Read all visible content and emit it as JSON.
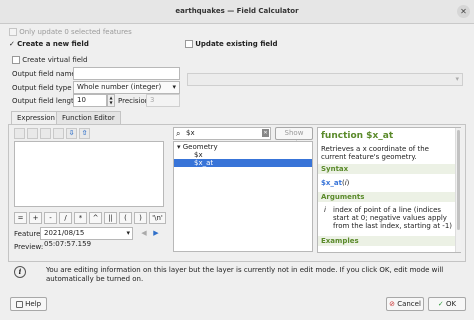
{
  "window": {
    "title": "earthquakes — Field Calculator",
    "close": "✕"
  },
  "only_update": {
    "label": "Only update 0 selected features"
  },
  "create_field": {
    "label": "Create a new field",
    "virtual_label": "Create virtual field",
    "name_label": "Output field name",
    "type_label": "Output field type",
    "type_value": "Whole number (integer)",
    "length_label": "Output field length",
    "length_value": "10",
    "precision_label": "Precision",
    "precision_value": "3"
  },
  "update_existing": {
    "label": "Update existing field"
  },
  "tabs": {
    "expression": "Expression",
    "function_editor": "Function Editor"
  },
  "operators": [
    "=",
    "+",
    "-",
    "/",
    "*",
    "^",
    "||",
    "(",
    ")",
    "'\\n'"
  ],
  "feature": {
    "label": "Feature",
    "value": "2021/08/15 05:07:57.159",
    "preview_label": "Preview:"
  },
  "search": {
    "value": "$x",
    "show_help": "Show Help"
  },
  "tree": {
    "group": "Geometry",
    "items": [
      "$x",
      "$x_at"
    ]
  },
  "help": {
    "title": "function $x_at",
    "description": "Retrieves a x coordinate of the current feature's geometry.",
    "syntax_heading": "Syntax",
    "syntax_fn": "$x_at",
    "syntax_arg": "i",
    "arguments_heading": "Arguments",
    "arg_name": "i",
    "arg_desc": "index of point of a line (indices start at 0; negative values apply from the last index, starting at -1)",
    "examples_heading": "Examples"
  },
  "info": {
    "icon": "i",
    "message": "You are editing information on this layer but the layer is currently not in edit mode. If you click OK, edit mode will automatically be turned on."
  },
  "buttons": {
    "help": "Help",
    "cancel": "Cancel",
    "ok": "OK"
  },
  "colors": {
    "accent": "#3874d8",
    "help_heading": "#5a8a2a"
  }
}
